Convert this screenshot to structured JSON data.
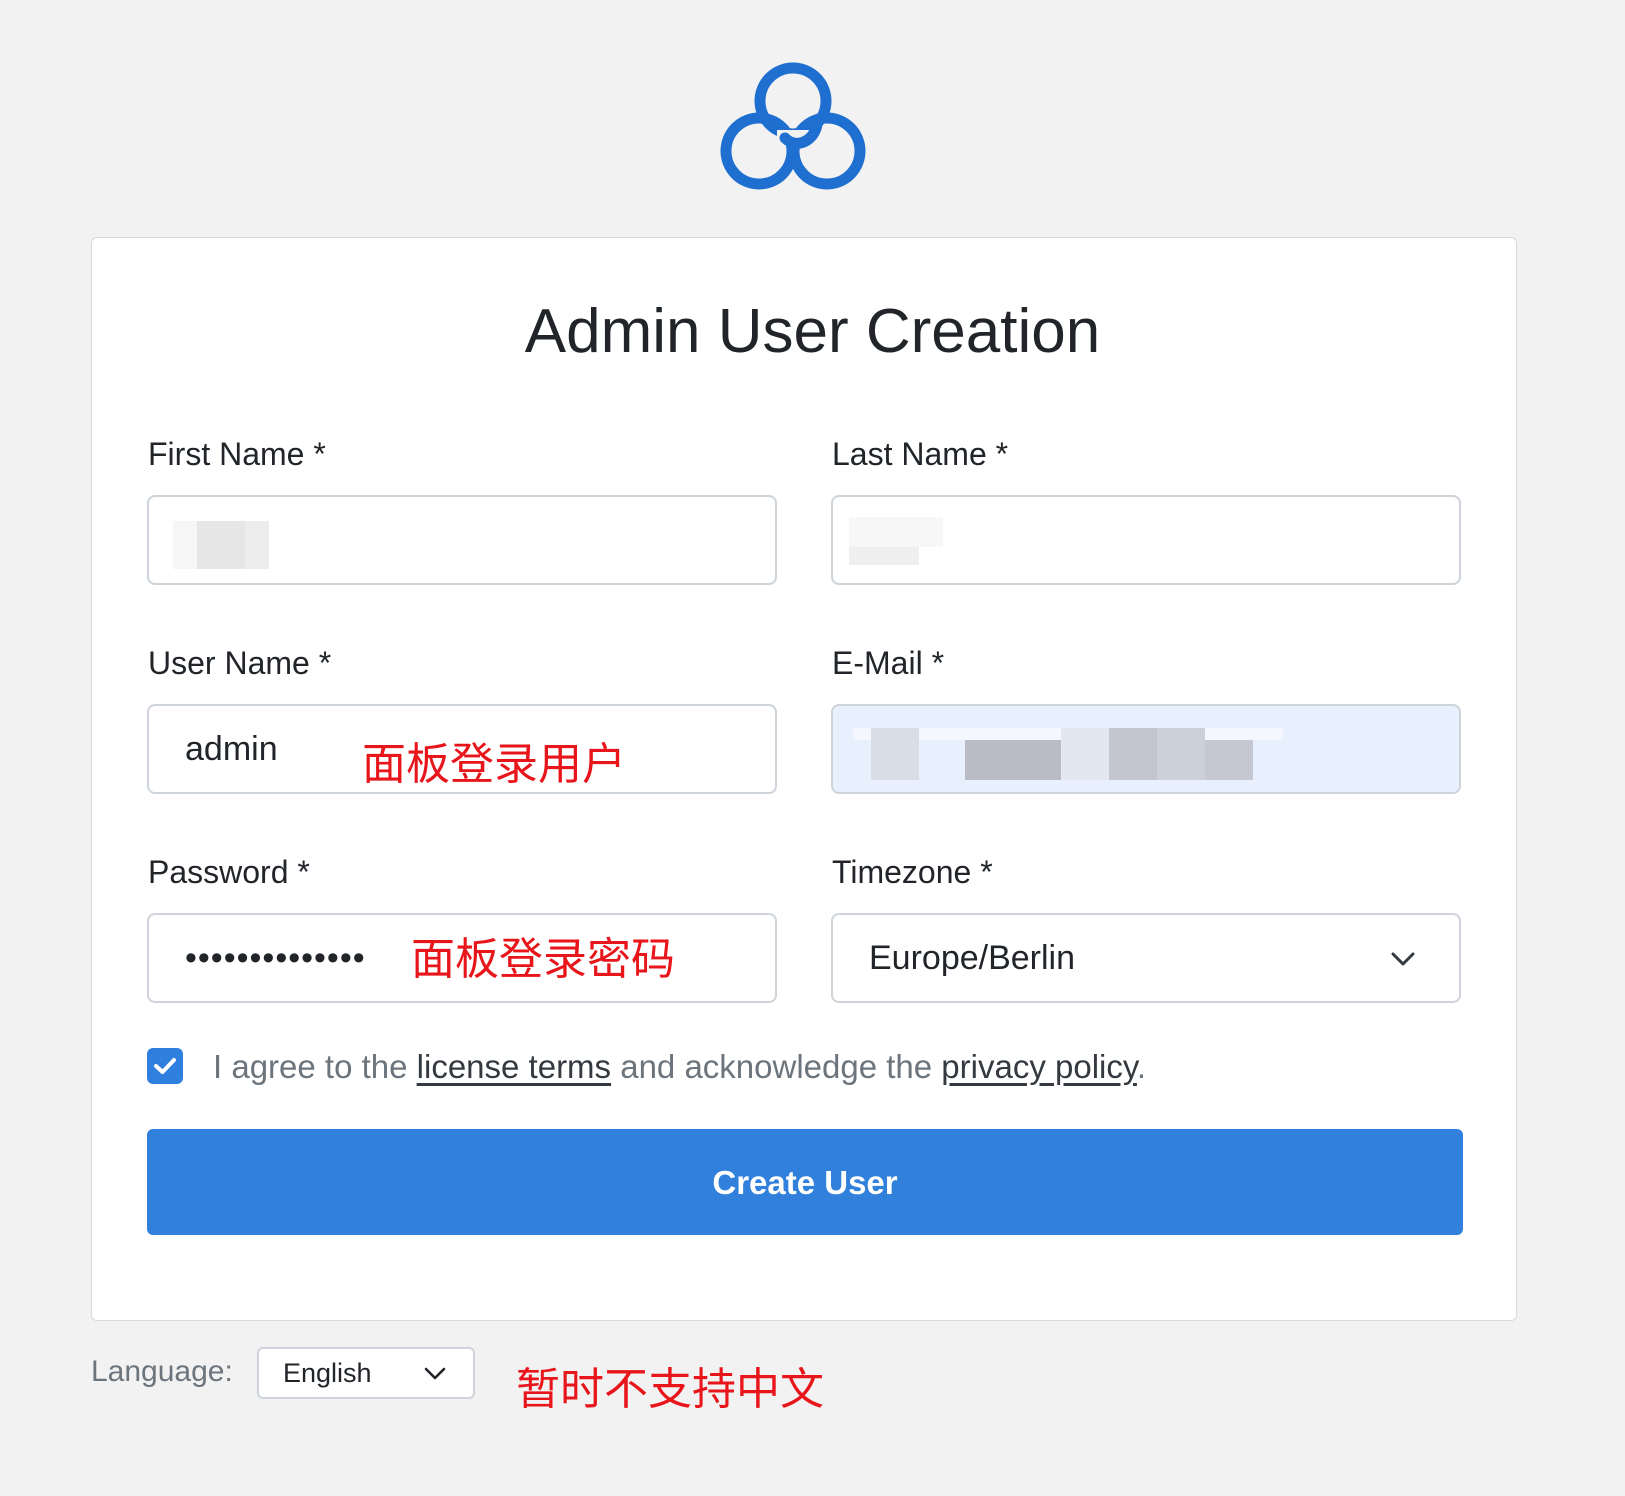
{
  "page": {
    "title": "Admin User Creation"
  },
  "colors": {
    "accent": "#3080dc",
    "logo": "#1f6fd0",
    "annotation": "#e8151b",
    "background": "#f2f2f2"
  },
  "icons": {
    "logo": "cloud-logo-icon",
    "checkbox": "checkmark-icon",
    "select": "chevron-down-icon"
  },
  "form": {
    "first_name": {
      "label": "First Name *",
      "value": ""
    },
    "last_name": {
      "label": "Last Name *",
      "value": ""
    },
    "user_name": {
      "label": "User Name *",
      "value": "admin",
      "annotation": "面板登录用户"
    },
    "email": {
      "label": "E-Mail *",
      "value": ""
    },
    "password": {
      "label": "Password *",
      "value": "••••••••••••••",
      "annotation": "面板登录密码"
    },
    "timezone": {
      "label": "Timezone *",
      "value": "Europe/Berlin"
    },
    "agree": {
      "checked": true,
      "text_before": "I agree to the",
      "license_link": "license terms",
      "text_middle": "and acknowledge the",
      "privacy_link": "privacy policy",
      "text_after": "."
    },
    "submit_label": "Create User"
  },
  "footer": {
    "language_label": "Language:",
    "language_value": "English",
    "annotation": "暂时不支持中文"
  }
}
